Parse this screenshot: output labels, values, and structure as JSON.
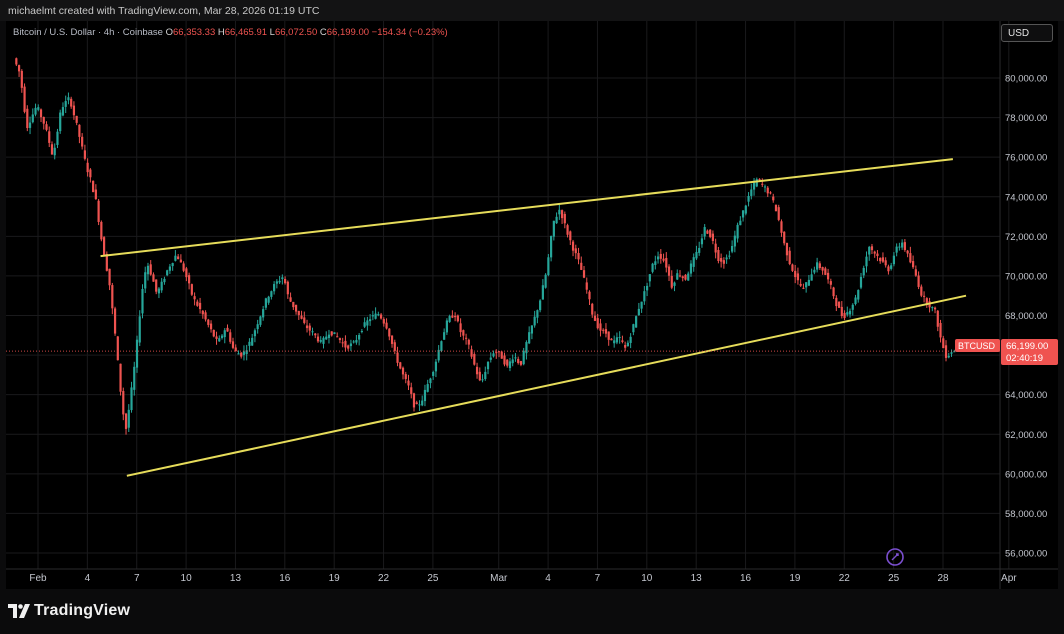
{
  "header": {
    "credit": "michaelmt created with TradingView.com, Mar 28, 2026 01:19 UTC"
  },
  "legend": {
    "symbol": "Bitcoin / U.S. Dollar · 4h · Coinbase",
    "open": "66,353.33",
    "high": "66,465.91",
    "low": "66,072.50",
    "close": "66,199.00",
    "change": "−154.34 (−0.23%)"
  },
  "currency_button": "USD",
  "last_price": {
    "ticker": "BTCUSD",
    "price": "66,199.00",
    "countdown": "02:40:19"
  },
  "brand": "TradingView",
  "colors": {
    "up": "#26a69a",
    "down": "#ef5350",
    "trendline": "#e6dc5a",
    "grid": "#1a1a1c",
    "background": "#000000"
  },
  "chart_data": {
    "type": "candlestick",
    "title": "Bitcoin / U.S. Dollar · 4h · Coinbase",
    "ylim": [
      55400,
      81200
    ],
    "xlim_days": [
      -1.5,
      58
    ],
    "y_ticks": [
      {
        "v": 80000,
        "label": "80,000.00"
      },
      {
        "v": 78000,
        "label": "78,000.00"
      },
      {
        "v": 76000,
        "label": "76,000.00"
      },
      {
        "v": 74000,
        "label": "74,000.00"
      },
      {
        "v": 72000,
        "label": "72,000.00"
      },
      {
        "v": 70000,
        "label": "70,000.00"
      },
      {
        "v": 68000,
        "label": "68,000.00"
      },
      {
        "v": 66000,
        "label": "66,000.00"
      },
      {
        "v": 64000,
        "label": "64,000.00"
      },
      {
        "v": 62000,
        "label": "62,000.00"
      },
      {
        "v": 60000,
        "label": "60,000.00"
      },
      {
        "v": 58000,
        "label": "58,000.00"
      },
      {
        "v": 56000,
        "label": "56,000.00"
      }
    ],
    "x_ticks": [
      {
        "label": "Feb",
        "day": 0
      },
      {
        "label": "4",
        "day": 3
      },
      {
        "label": "7",
        "day": 6
      },
      {
        "label": "10",
        "day": 9
      },
      {
        "label": "13",
        "day": 12
      },
      {
        "label": "16",
        "day": 15
      },
      {
        "label": "19",
        "day": 18
      },
      {
        "label": "22",
        "day": 21
      },
      {
        "label": "25",
        "day": 24
      },
      {
        "label": "Mar",
        "day": 28
      },
      {
        "label": "4",
        "day": 31
      },
      {
        "label": "7",
        "day": 34
      },
      {
        "label": "10",
        "day": 37
      },
      {
        "label": "13",
        "day": 40
      },
      {
        "label": "16",
        "day": 43
      },
      {
        "label": "19",
        "day": 46
      },
      {
        "label": "22",
        "day": 49
      },
      {
        "label": "25",
        "day": 52
      },
      {
        "label": "28",
        "day": 55
      },
      {
        "label": "Apr",
        "day": 59
      }
    ],
    "price_path": [
      [
        -1.4,
        81000
      ],
      [
        -1.0,
        80200
      ],
      [
        -0.6,
        77500
      ],
      [
        0.0,
        78600
      ],
      [
        0.5,
        77600
      ],
      [
        1.0,
        76000
      ],
      [
        1.5,
        78500
      ],
      [
        2.0,
        79000
      ],
      [
        2.5,
        77400
      ],
      [
        3.0,
        75600
      ],
      [
        3.3,
        74800
      ],
      [
        3.6,
        73800
      ],
      [
        4.0,
        71500
      ],
      [
        4.4,
        69800
      ],
      [
        4.8,
        66800
      ],
      [
        5.1,
        64200
      ],
      [
        5.4,
        62100
      ],
      [
        5.7,
        63800
      ],
      [
        6.0,
        65800
      ],
      [
        6.4,
        69200
      ],
      [
        6.7,
        70700
      ],
      [
        7.0,
        70000
      ],
      [
        7.3,
        69100
      ],
      [
        7.6,
        69600
      ],
      [
        8.0,
        70400
      ],
      [
        8.5,
        71100
      ],
      [
        9.0,
        70200
      ],
      [
        9.5,
        68900
      ],
      [
        10.0,
        68200
      ],
      [
        10.5,
        67400
      ],
      [
        11.0,
        66600
      ],
      [
        11.5,
        67400
      ],
      [
        12.0,
        66200
      ],
      [
        12.5,
        66000
      ],
      [
        13.0,
        66700
      ],
      [
        13.5,
        67800
      ],
      [
        14.0,
        68900
      ],
      [
        14.5,
        69600
      ],
      [
        15.0,
        70000
      ],
      [
        15.3,
        68900
      ],
      [
        15.8,
        68200
      ],
      [
        16.3,
        67500
      ],
      [
        16.8,
        67100
      ],
      [
        17.3,
        66600
      ],
      [
        17.8,
        67200
      ],
      [
        18.3,
        66900
      ],
      [
        18.8,
        66400
      ],
      [
        19.3,
        66600
      ],
      [
        19.8,
        67400
      ],
      [
        20.3,
        67900
      ],
      [
        20.8,
        68100
      ],
      [
        21.3,
        67400
      ],
      [
        21.8,
        66000
      ],
      [
        22.2,
        65100
      ],
      [
        22.6,
        64400
      ],
      [
        23.0,
        63300
      ],
      [
        23.4,
        63700
      ],
      [
        23.8,
        64600
      ],
      [
        24.2,
        65500
      ],
      [
        24.6,
        66800
      ],
      [
        25.0,
        67800
      ],
      [
        25.4,
        68100
      ],
      [
        25.8,
        67100
      ],
      [
        26.2,
        66600
      ],
      [
        26.6,
        65500
      ],
      [
        27.0,
        64500
      ],
      [
        27.4,
        65600
      ],
      [
        27.8,
        66200
      ],
      [
        28.2,
        66000
      ],
      [
        28.6,
        65400
      ],
      [
        29.0,
        66000
      ],
      [
        29.4,
        65500
      ],
      [
        29.8,
        66700
      ],
      [
        30.2,
        67700
      ],
      [
        30.6,
        68800
      ],
      [
        31.0,
        70300
      ],
      [
        31.4,
        72700
      ],
      [
        31.8,
        73400
      ],
      [
        32.2,
        72300
      ],
      [
        32.6,
        71400
      ],
      [
        33.0,
        70600
      ],
      [
        33.4,
        69400
      ],
      [
        33.8,
        68000
      ],
      [
        34.2,
        67300
      ],
      [
        34.6,
        67100
      ],
      [
        35.0,
        66600
      ],
      [
        35.4,
        66900
      ],
      [
        35.8,
        66300
      ],
      [
        36.2,
        67300
      ],
      [
        36.6,
        68400
      ],
      [
        37.0,
        69300
      ],
      [
        37.4,
        70500
      ],
      [
        37.8,
        71100
      ],
      [
        38.2,
        70700
      ],
      [
        38.6,
        69500
      ],
      [
        39.0,
        70200
      ],
      [
        39.4,
        69800
      ],
      [
        39.8,
        70600
      ],
      [
        40.2,
        71300
      ],
      [
        40.6,
        72400
      ],
      [
        41.0,
        72000
      ],
      [
        41.4,
        70900
      ],
      [
        41.8,
        70700
      ],
      [
        42.2,
        71300
      ],
      [
        42.6,
        72500
      ],
      [
        43.0,
        73400
      ],
      [
        43.4,
        74300
      ],
      [
        43.8,
        74900
      ],
      [
        44.2,
        74500
      ],
      [
        44.6,
        74100
      ],
      [
        45.0,
        73200
      ],
      [
        45.4,
        71700
      ],
      [
        45.8,
        70600
      ],
      [
        46.2,
        69800
      ],
      [
        46.6,
        69300
      ],
      [
        47.0,
        70000
      ],
      [
        47.4,
        70600
      ],
      [
        47.8,
        70300
      ],
      [
        48.2,
        69600
      ],
      [
        48.6,
        68600
      ],
      [
        49.0,
        67900
      ],
      [
        49.4,
        68300
      ],
      [
        49.8,
        68900
      ],
      [
        50.2,
        70300
      ],
      [
        50.6,
        71500
      ],
      [
        51.0,
        71100
      ],
      [
        51.4,
        70700
      ],
      [
        51.8,
        70300
      ],
      [
        52.2,
        71300
      ],
      [
        52.6,
        71700
      ],
      [
        53.0,
        70900
      ],
      [
        53.4,
        70100
      ],
      [
        53.8,
        69000
      ],
      [
        54.2,
        68600
      ],
      [
        54.6,
        68200
      ],
      [
        55.0,
        66600
      ],
      [
        55.3,
        65900
      ],
      [
        55.6,
        66200
      ]
    ],
    "trendlines": [
      {
        "name": "upper",
        "from": [
          3.8,
          71000
        ],
        "to": [
          55.6,
          75900
        ]
      },
      {
        "name": "lower",
        "from": [
          5.4,
          59900
        ],
        "to": [
          56.4,
          69000
        ]
      }
    ],
    "last_price_value": 66199
  }
}
